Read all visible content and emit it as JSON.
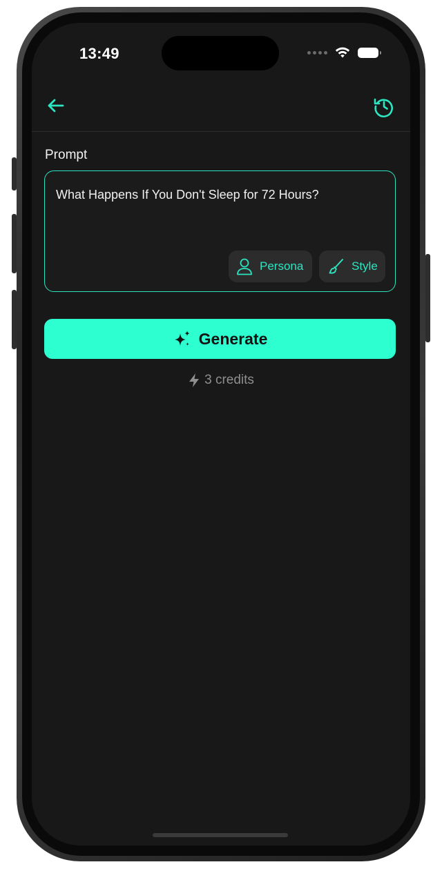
{
  "status_bar": {
    "time": "13:49"
  },
  "nav": {
    "back_icon": "arrow-left-icon",
    "history_icon": "history-icon"
  },
  "prompt": {
    "label": "Prompt",
    "value": "What Happens If You Don't Sleep for 72 Hours?",
    "persona_label": "Persona",
    "style_label": "Style"
  },
  "generate": {
    "label": "Generate"
  },
  "credits": {
    "label": "3 credits"
  },
  "colors": {
    "accent": "#2de5c0",
    "button": "#2effd0",
    "background": "#181818",
    "chip_bg": "#2c2c2c"
  }
}
